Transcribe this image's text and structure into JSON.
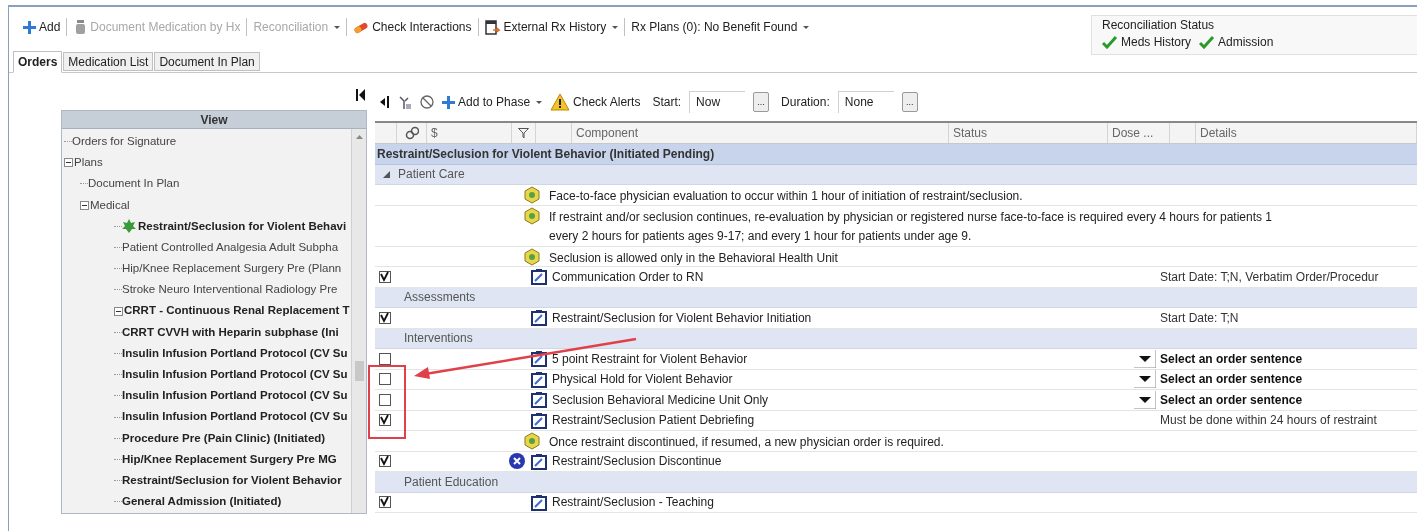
{
  "toolbar": {
    "items": [
      {
        "kind": "add",
        "label": "Add",
        "disabled": false,
        "dropdown": false
      },
      {
        "kind": "document",
        "label": "Document Medication by Hx",
        "disabled": true,
        "dropdown": false
      },
      {
        "kind": "reconcile",
        "label": "Reconciliation",
        "disabled": true,
        "dropdown": true
      },
      {
        "kind": "interactions",
        "label": "Check Interactions",
        "disabled": false,
        "dropdown": false
      },
      {
        "kind": "history",
        "label": "External Rx History",
        "disabled": false,
        "dropdown": true
      },
      {
        "kind": "plans",
        "label": "Rx Plans (0): No Benefit Found",
        "disabled": false,
        "dropdown": true
      }
    ]
  },
  "reconciliation_status": {
    "title": "Reconciliation Status",
    "items": [
      {
        "label": "Meds History",
        "done": true
      },
      {
        "label": "Admission",
        "done": true
      }
    ]
  },
  "tabs": [
    {
      "label": "Orders",
      "selected": true
    },
    {
      "label": "Medication List",
      "selected": false
    },
    {
      "label": "Document In Plan",
      "selected": false
    }
  ],
  "tree": {
    "header": "View",
    "items": [
      {
        "label": "Orders for Signature",
        "bold": false,
        "flagged": false
      },
      {
        "label": "Plans",
        "bold": false,
        "flagged": false,
        "expanded": true,
        "children": [
          {
            "label": "Document In Plan",
            "bold": false,
            "flagged": false
          },
          {
            "label": "Medical",
            "bold": false,
            "flagged": false,
            "expanded": true,
            "children": [
              {
                "label": "Restraint/Seclusion for Violent Behavi",
                "bold": true,
                "flagged": true
              },
              {
                "label": "Patient Controlled Analgesia Adult Subpha",
                "bold": false,
                "flagged": false
              },
              {
                "label": "Hip/Knee Replacement Surgery  Pre (Plann",
                "bold": false,
                "flagged": false
              },
              {
                "label": "Stroke Neuro Interventional Radiology Pre",
                "bold": false,
                "flagged": false
              },
              {
                "label": "CRRT - Continuous Renal Replacement T",
                "bold": true,
                "flagged": false,
                "expanded": true,
                "children": [
                  {
                    "label": "CRRT CVVH with Heparin subphase (Ini",
                    "bold": true,
                    "flagged": false
                  }
                ]
              },
              {
                "label": "Insulin Infusion Portland Protocol (CV Su",
                "bold": true,
                "flagged": false
              },
              {
                "label": "Insulin Infusion Portland Protocol (CV Su",
                "bold": true,
                "flagged": false
              },
              {
                "label": "Insulin Infusion Portland Protocol (CV Su",
                "bold": true,
                "flagged": false
              },
              {
                "label": "Insulin Infusion Portland Protocol (CV Su",
                "bold": true,
                "flagged": false
              },
              {
                "label": "Procedure Pre (Pain Clinic) (Initiated)",
                "bold": true,
                "flagged": false
              },
              {
                "label": "Hip/Knee Replacement Surgery  Pre MG",
                "bold": true,
                "flagged": false
              },
              {
                "label": "Restraint/Seclusion for Violent Behavior",
                "bold": true,
                "flagged": false
              },
              {
                "label": "General Admission (Initiated)",
                "bold": true,
                "flagged": false
              }
            ]
          }
        ]
      }
    ]
  },
  "grid_toolbar": {
    "items": [
      {
        "kind": "add",
        "label": "Add to Phase",
        "dropdown": true
      },
      {
        "kind": "alerts",
        "label": "Check Alerts",
        "dropdown": false
      }
    ],
    "start": {
      "label": "Start:",
      "value": "Now",
      "button": "..."
    },
    "duration": {
      "label": "Duration:",
      "value": "None",
      "button": "..."
    }
  },
  "grid_header": {
    "price": "$",
    "component": "Component",
    "status": "Status",
    "dose": "Dose ...",
    "details": "Details"
  },
  "rows": [
    {
      "kind": "title",
      "text": "Restraint/Seclusion for Violent Behavior (Initiated Pending)"
    },
    {
      "kind": "section",
      "text": "Patient Care",
      "toggle": true
    },
    {
      "kind": "note",
      "lines": [
        "Face-to-face physician evaluation to occur within 1 hour of initiation of restraint/seclusion."
      ]
    },
    {
      "kind": "note",
      "lines": [
        "If restraint and/or seclusion continues, re-evaluation by physician or registered nurse face-to-face is required every 4 hours for patients 1",
        "every 2 hours for patients ages 9-17; and every 1 hour for patients under age 9."
      ]
    },
    {
      "kind": "note",
      "lines": [
        "Seclusion is allowed only in the Behavioral Health Unit"
      ]
    },
    {
      "kind": "order",
      "checked": true,
      "component": "Communication Order to RN",
      "details": "Start Date: T;N, Verbatim Order/Procedur",
      "prompt": false,
      "discontinue": false
    },
    {
      "kind": "section",
      "text": "Assessments",
      "toggle": false
    },
    {
      "kind": "order",
      "checked": true,
      "component": "Restraint/Seclusion for Violent Behavior Initiation",
      "details": "Start Date: T;N",
      "prompt": false,
      "discontinue": false
    },
    {
      "kind": "section",
      "text": "Interventions",
      "toggle": false
    },
    {
      "kind": "order",
      "checked": false,
      "component": "5 point Restraint for Violent Behavior",
      "details": "Select an order sentence",
      "prompt": true,
      "discontinue": false
    },
    {
      "kind": "order",
      "checked": false,
      "component": "Physical Hold for Violent Behavior",
      "details": "Select an order sentence",
      "prompt": true,
      "discontinue": false
    },
    {
      "kind": "order",
      "checked": false,
      "component": "Seclusion Behavioral Medicine Unit Only",
      "details": "Select an order sentence",
      "prompt": true,
      "discontinue": false
    },
    {
      "kind": "order",
      "checked": true,
      "component": "Restraint/Seclusion Patient Debriefing",
      "details": "Must be done within 24 hours of restraint",
      "prompt": false,
      "discontinue": false
    },
    {
      "kind": "note",
      "lines": [
        "Once restraint discontinued, if resumed, a new physician order is required."
      ]
    },
    {
      "kind": "order",
      "checked": true,
      "component": "Restraint/Seclusion Discontinue",
      "prompt": false,
      "discontinue": true
    },
    {
      "kind": "section",
      "text": "Patient Education",
      "toggle": false
    },
    {
      "kind": "order",
      "checked": true,
      "component": "Restraint/Seclusion - Teaching",
      "prompt": false,
      "discontinue": false
    }
  ]
}
